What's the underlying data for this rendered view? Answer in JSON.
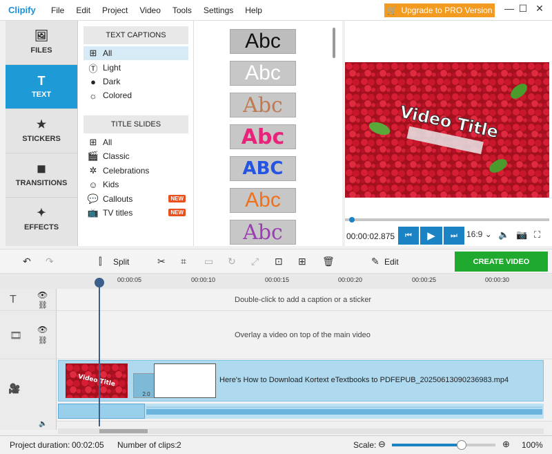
{
  "app": {
    "logo": "Clipify",
    "menu": [
      "File",
      "Edit",
      "Project",
      "Video",
      "Tools",
      "Settings",
      "Help"
    ],
    "upgrade_label": "Upgrade to PRO Version"
  },
  "left_tabs": [
    {
      "label": "FILES",
      "icon": "image-icon"
    },
    {
      "label": "TEXT",
      "icon": "text-t-icon"
    },
    {
      "label": "STICKERS",
      "icon": "star-icon"
    },
    {
      "label": "TRANSITIONS",
      "icon": "transitions-icon"
    },
    {
      "label": "EFFECTS",
      "icon": "magic-wand-icon"
    }
  ],
  "categories": {
    "captions_header": "TEXT CAPTIONS",
    "captions": [
      "All",
      "Light",
      "Dark",
      "Colored"
    ],
    "slides_header": "TITLE SLIDES",
    "slides": [
      "All",
      "Classic",
      "Celebrations",
      "Kids",
      "Callouts",
      "TV titles"
    ],
    "new_badge": "NEW"
  },
  "styles": [
    "Abc",
    "Abc",
    "Abc",
    "Abc",
    "ABC",
    "Abc",
    "Abc"
  ],
  "preview": {
    "overlay_title": "Video Title",
    "timecode": "00:00:02.875",
    "aspect": "16:9"
  },
  "toolbar": {
    "split_label": "Split",
    "edit_label": "Edit",
    "create_label": "CREATE VIDEO"
  },
  "timeline": {
    "ruler": [
      "00:00:05",
      "00:00:10",
      "00:00:15",
      "00:00:20",
      "00:00:25",
      "00:00:30"
    ],
    "caption_hint": "Double-click to add a caption or a sticker",
    "overlay_hint": "Overlay a video on top of the main video",
    "clip_title": "Here's How to Download Kortext eTextbooks to PDFEPUB_20250613090236983.mp4",
    "transition_value": "2.0"
  },
  "status": {
    "duration_label": "Project duration:",
    "duration": "00:02:05",
    "clips_label": "Number of clips:",
    "clips": "2",
    "scale_label": "Scale:",
    "zoom": "100%",
    "scale_fraction": 0.67
  }
}
